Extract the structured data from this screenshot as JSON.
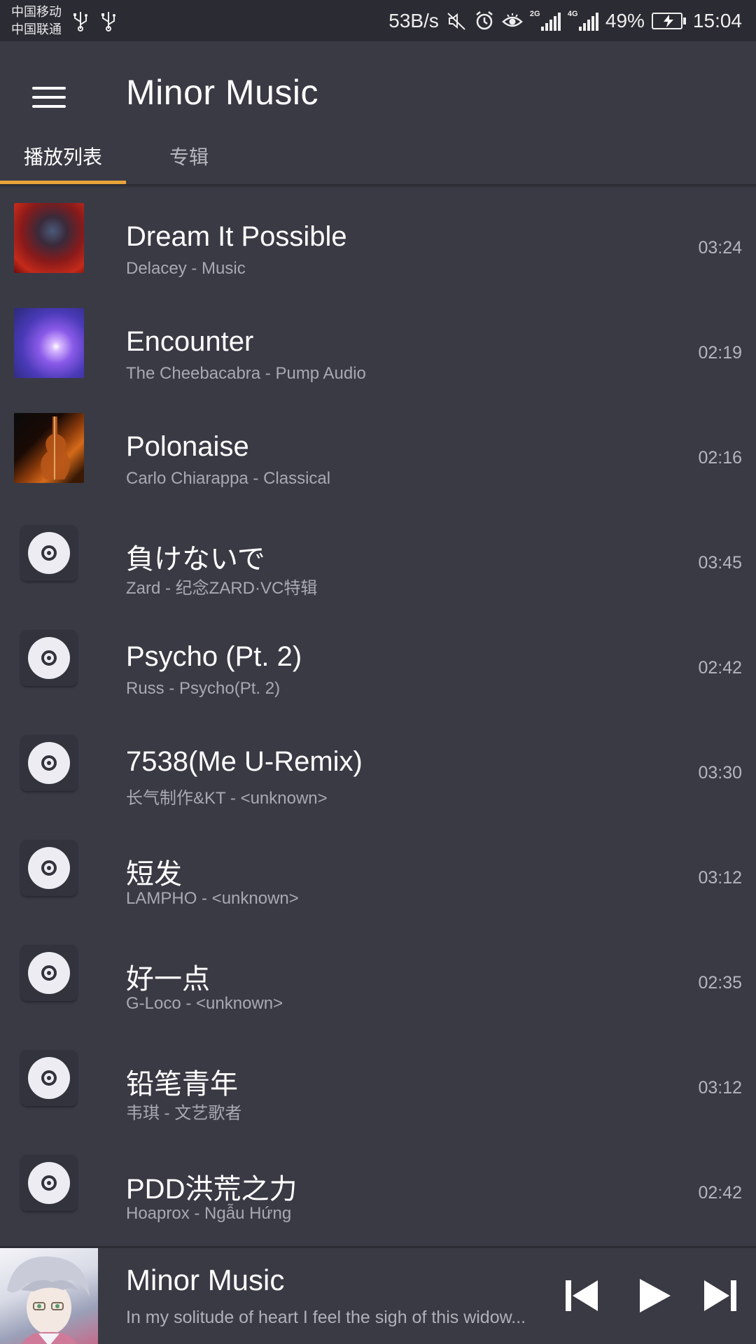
{
  "status_bar": {
    "carrier_1": "中国移动",
    "carrier_2": "中国联通",
    "net_speed": "53B/s",
    "net_type_1": "2G",
    "net_type_2": "4G",
    "battery": "49%",
    "time": "15:04"
  },
  "app_bar": {
    "title": "Minor Music",
    "tabs": [
      {
        "label": "播放列表",
        "active": true
      },
      {
        "label": "专辑",
        "active": false
      }
    ]
  },
  "songs": [
    {
      "title": "Dream It Possible",
      "subtitle": "Delacey - Music",
      "duration": "03:24",
      "art": "nebula-photo"
    },
    {
      "title": "Encounter",
      "subtitle": "The Cheebacabra - Pump Audio",
      "duration": "02:19",
      "art": "light-burst-photo"
    },
    {
      "title": "Polonaise",
      "subtitle": "Carlo Chiarappa - Classical",
      "duration": "02:16",
      "art": "violin-photo"
    },
    {
      "title": "負けないで",
      "subtitle": "Zard - 纪念ZARD·VC特辑",
      "duration": "03:45",
      "art": "disc-icon"
    },
    {
      "title": "Psycho (Pt. 2)",
      "subtitle": "Russ - Psycho(Pt. 2)",
      "duration": "02:42",
      "art": "disc-icon"
    },
    {
      "title": "7538(Me U-Remix)",
      "subtitle": "长气制作&KT - <unknown>",
      "duration": "03:30",
      "art": "disc-icon"
    },
    {
      "title": "短发",
      "subtitle": "LAMPHO - <unknown>",
      "duration": "03:12",
      "art": "disc-icon"
    },
    {
      "title": "好一点",
      "subtitle": "G-Loco - <unknown>",
      "duration": "02:35",
      "art": "disc-icon"
    },
    {
      "title": "铅笔青年",
      "subtitle": "韦琪 - 文艺歌者",
      "duration": "03:12",
      "art": "disc-icon"
    },
    {
      "title": "PDD洪荒之力",
      "subtitle": "Hoaprox - Ngẫu Hứng",
      "duration": "02:42",
      "art": "disc-icon"
    }
  ],
  "now_playing": {
    "title": "Minor Music",
    "subtitle": "In my solitude of heart I feel the sigh of this widow..."
  },
  "colors": {
    "background": "#3a3a45",
    "status_bar": "#2b2b33",
    "tab_indicator": "#e9a43a",
    "secondary_text": "#a9a9b3"
  }
}
